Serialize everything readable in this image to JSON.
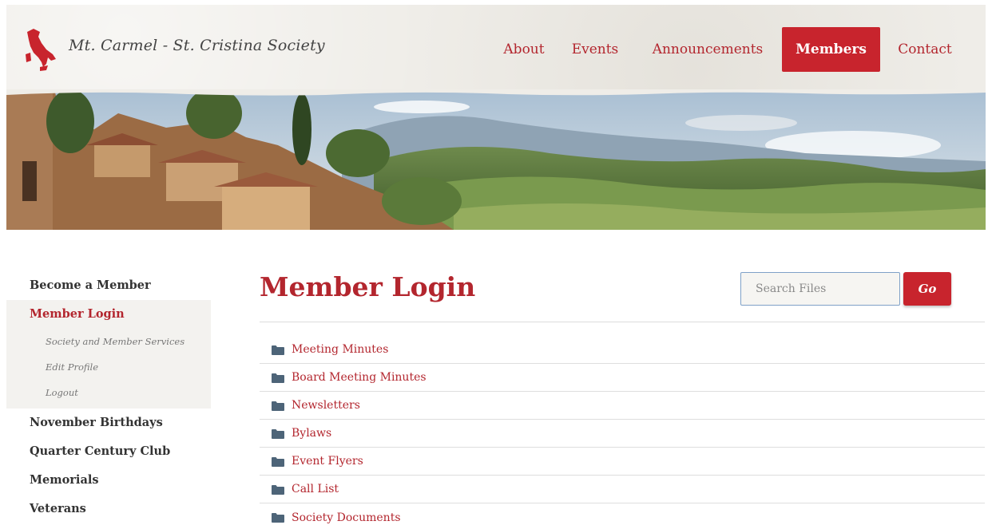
{
  "site": {
    "title": "Mt. Carmel - St. Cristina Society"
  },
  "nav": {
    "items": [
      {
        "label": "About"
      },
      {
        "label": "Events"
      },
      {
        "label": "Announcements"
      },
      {
        "label": "Members",
        "active": true
      },
      {
        "label": "Contact"
      }
    ]
  },
  "sidebar": {
    "items": [
      {
        "label": "Become a Member"
      },
      {
        "label": "Member Login",
        "current": true,
        "children": [
          {
            "label": "Society and Member Services"
          },
          {
            "label": "Edit Profile"
          },
          {
            "label": "Logout"
          }
        ]
      },
      {
        "label": "November Birthdays"
      },
      {
        "label": "Quarter Century Club"
      },
      {
        "label": "Memorials"
      },
      {
        "label": "Veterans"
      }
    ]
  },
  "main": {
    "title": "Member Login",
    "search": {
      "placeholder": "Search Files",
      "value": "",
      "button_label": "Go"
    },
    "folders": [
      {
        "label": "Meeting Minutes"
      },
      {
        "label": "Board Meeting Minutes"
      },
      {
        "label": "Newsletters"
      },
      {
        "label": "Bylaws"
      },
      {
        "label": "Event Flyers"
      },
      {
        "label": "Call List"
      },
      {
        "label": "Society Documents"
      }
    ]
  },
  "icons": {
    "logo": "italy-map-icon",
    "folder": "folder-icon"
  },
  "colors": {
    "accent": "#c8242d",
    "link": "#b3262e",
    "header_bg": "#efede8",
    "sidebar_active_bg": "#f3f2ef",
    "folder_icon": "#4d6478",
    "search_border": "#7fa1c8"
  }
}
